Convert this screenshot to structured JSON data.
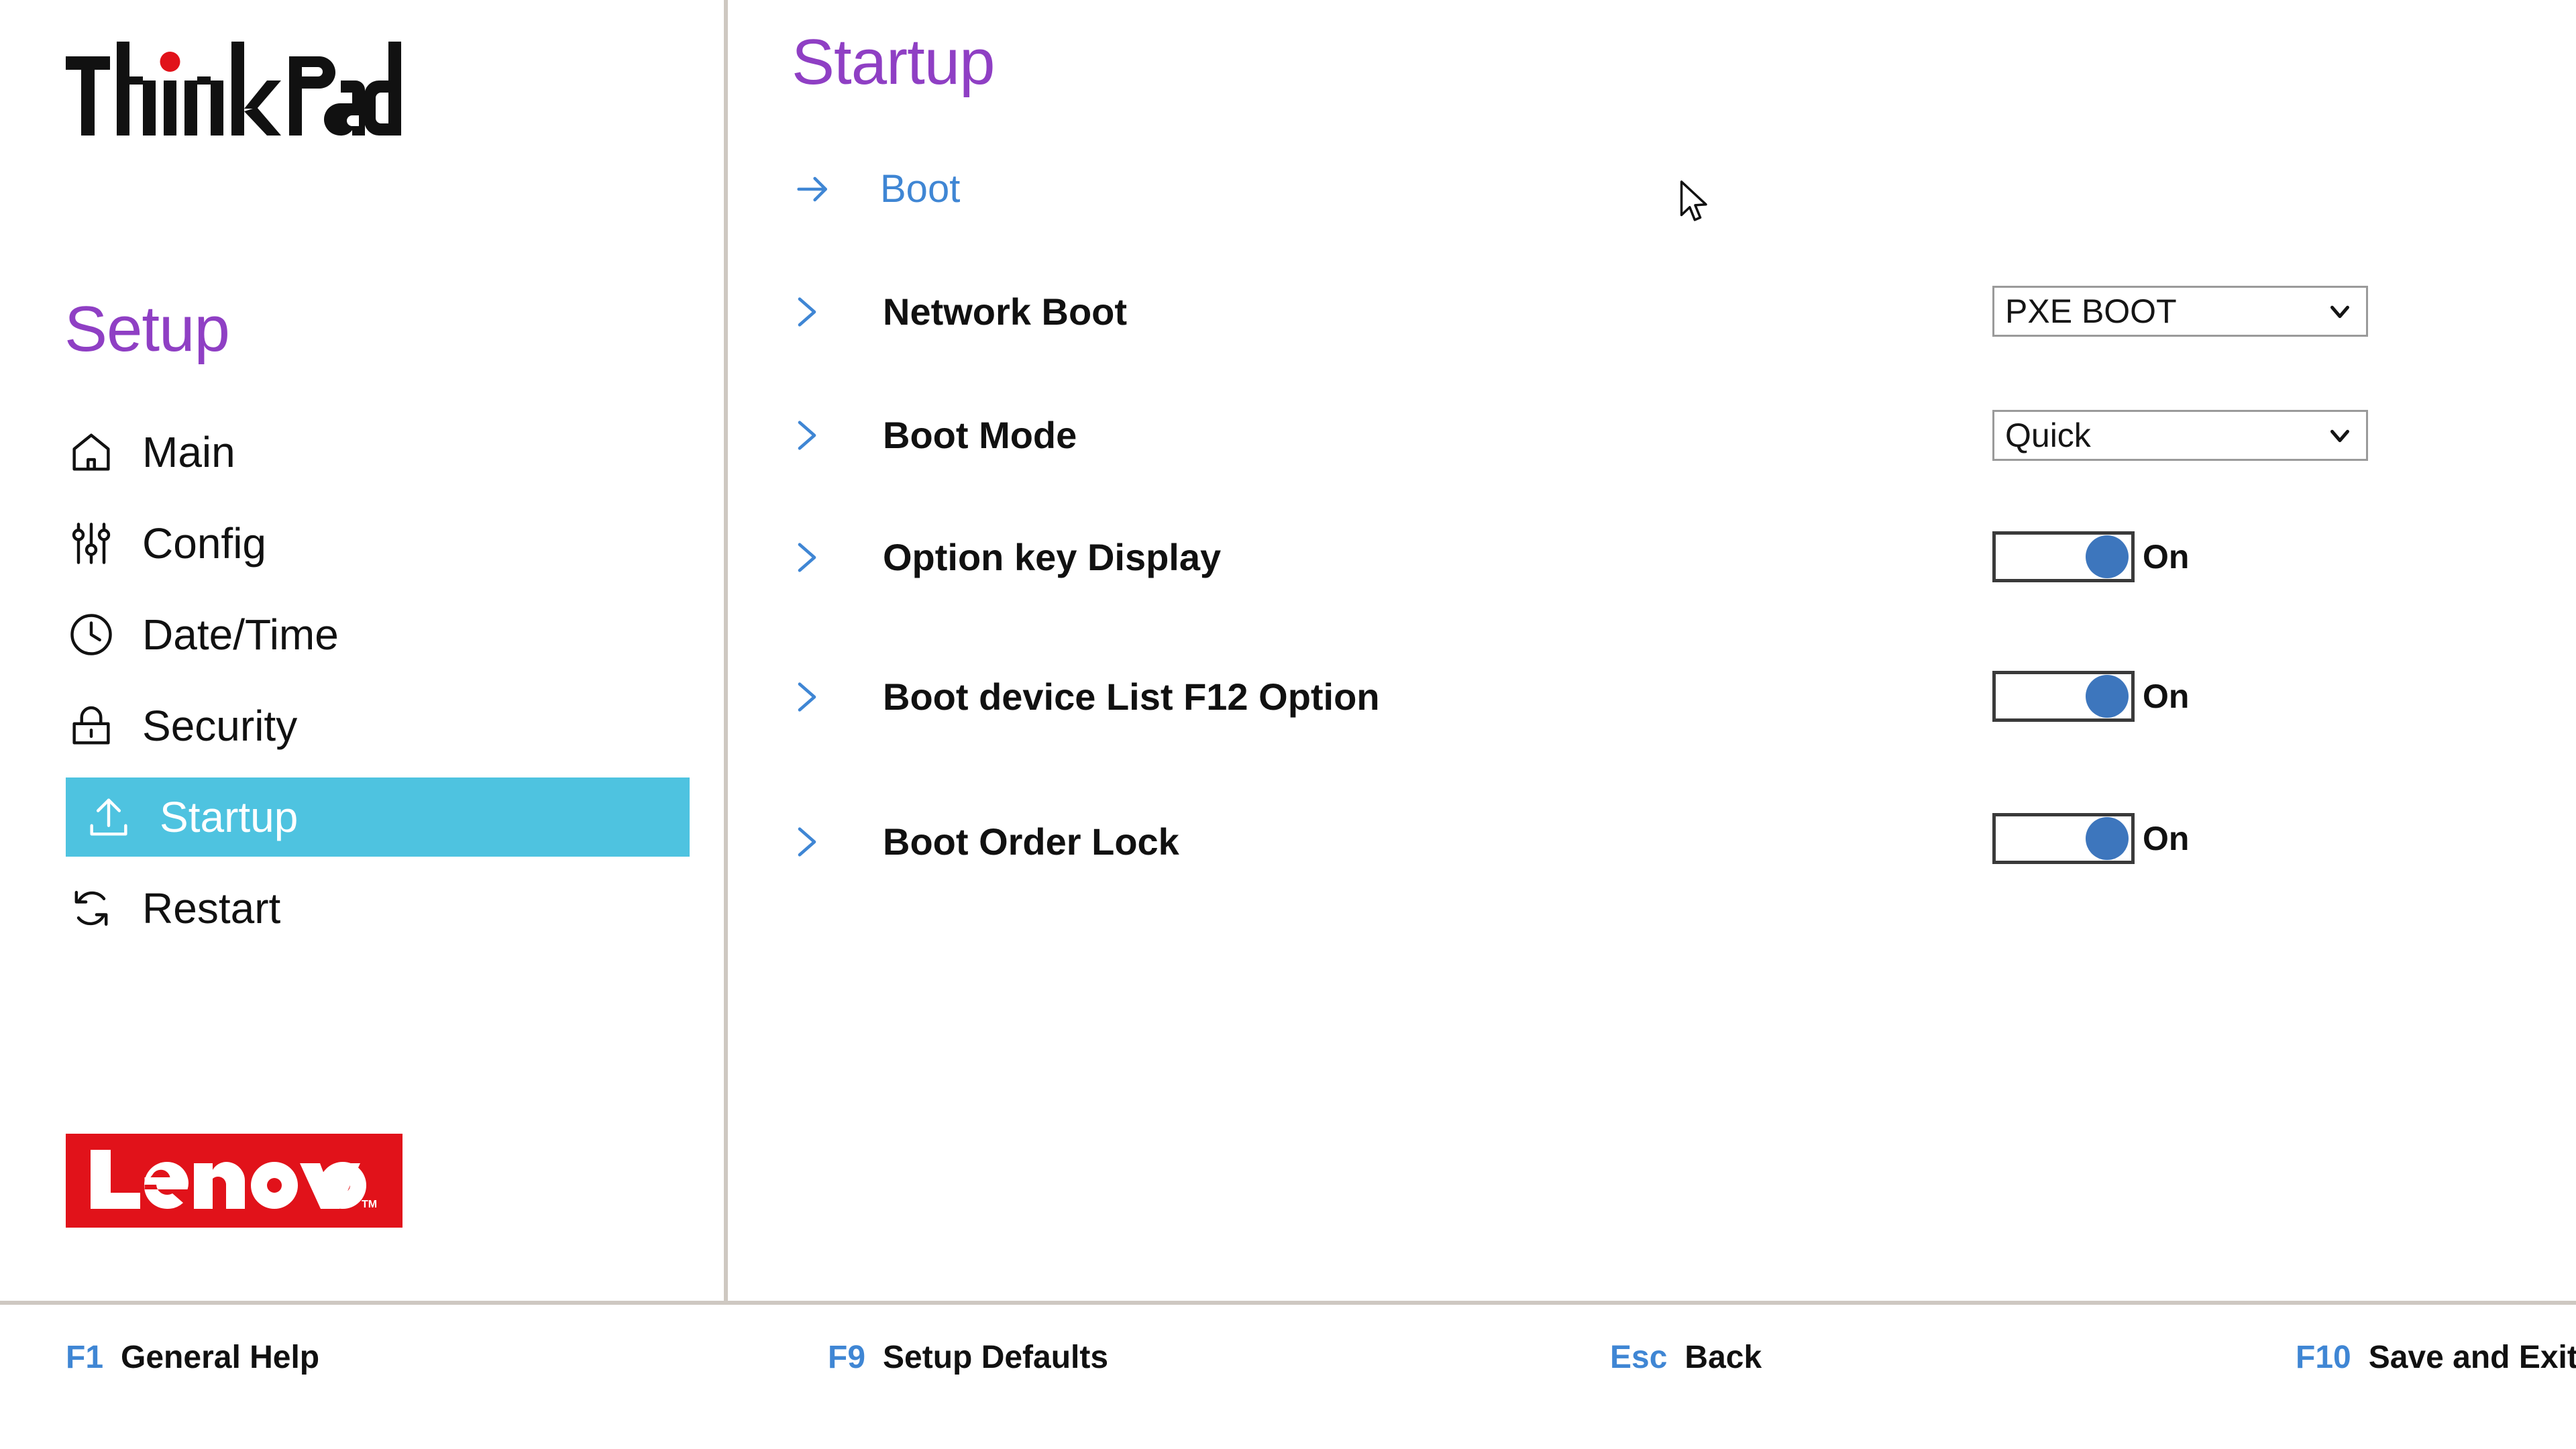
{
  "brand": {
    "product_logo_text": "ThinkPad",
    "vendor_logo_text": "Lenovo",
    "vendor_trademark": "TM",
    "accent_cyan": "#4ec3e0",
    "accent_purple": "#8f3fc4",
    "accent_blue": "#3f86d4",
    "toggle_blue": "#3d76bd",
    "vendor_red": "#e1121a"
  },
  "sidebar": {
    "heading": "Setup",
    "items": [
      {
        "label": "Main",
        "icon": "home-icon",
        "active": false
      },
      {
        "label": "Config",
        "icon": "sliders-icon",
        "active": false
      },
      {
        "label": "Date/Time",
        "icon": "clock-icon",
        "active": false
      },
      {
        "label": "Security",
        "icon": "lock-icon",
        "active": false
      },
      {
        "label": "Startup",
        "icon": "upload-icon",
        "active": true
      },
      {
        "label": "Restart",
        "icon": "refresh-icon",
        "active": false
      }
    ]
  },
  "main": {
    "title": "Startup",
    "link_row": {
      "label": "Boot",
      "icon": "arrow-right-icon"
    },
    "settings": [
      {
        "label": "Network Boot",
        "icon": "chevron-right-icon",
        "control": "dropdown",
        "value": "PXE BOOT"
      },
      {
        "label": "Boot Mode",
        "icon": "chevron-right-icon",
        "control": "dropdown",
        "value": "Quick"
      },
      {
        "label": "Option key Display",
        "icon": "chevron-right-icon",
        "control": "toggle",
        "value": "On"
      },
      {
        "label": "Boot device List F12 Option",
        "icon": "chevron-right-icon",
        "control": "toggle",
        "value": "On"
      },
      {
        "label": "Boot Order Lock",
        "icon": "chevron-right-icon",
        "control": "toggle",
        "value": "On"
      }
    ]
  },
  "footer": {
    "keys": [
      {
        "key": "F1",
        "text": "General Help"
      },
      {
        "key": "F9",
        "text": "Setup Defaults"
      },
      {
        "key": "Esc",
        "text": "Back"
      },
      {
        "key": "F10",
        "text": "Save and Exit"
      }
    ]
  },
  "cursor": {
    "icon": "mouse-pointer-icon"
  }
}
